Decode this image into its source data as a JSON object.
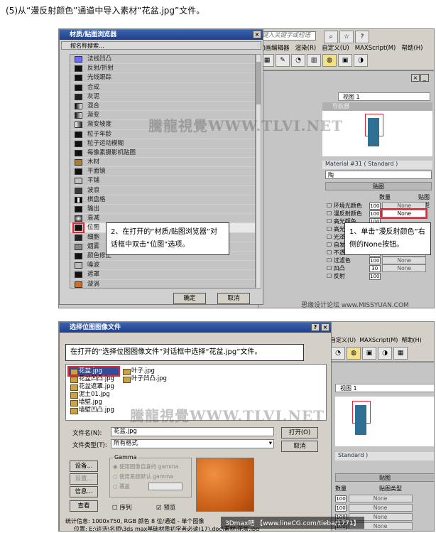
{
  "heading": "(5)从“漫反射颜色”通道中导入素材“花盆.jpg”文件。",
  "top": {
    "browser": {
      "title": "材质/贴图浏览器",
      "search_placeholder": "按名称搜索...",
      "items": [
        {
          "label": "法线凹凸",
          "color": "#6b6bff"
        },
        {
          "label": "反射/折射",
          "color": "#111111"
        },
        {
          "label": "光线跟踪",
          "color": "#111111"
        },
        {
          "label": "合成",
          "color": "#111111"
        },
        {
          "label": "灰泥",
          "color": "#202020"
        },
        {
          "label": "混合",
          "color": "#777777"
        },
        {
          "label": "渐变",
          "color": "#333333"
        },
        {
          "label": "渐变坡度",
          "color": "#999999"
        },
        {
          "label": "粒子年龄",
          "color": "#111111"
        },
        {
          "label": "粒子运动模糊",
          "color": "#111111"
        },
        {
          "label": "每像素摄影机贴图",
          "color": "#111111"
        },
        {
          "label": "木材",
          "color": "#b07a2a"
        },
        {
          "label": "平面镜",
          "color": "#111111"
        },
        {
          "label": "平铺",
          "color": "#c0c0c0"
        },
        {
          "label": "波浪",
          "color": "#3a3a3a"
        },
        {
          "label": "棋盘格",
          "color": "#555555"
        },
        {
          "label": "输出",
          "color": "#111111"
        },
        {
          "label": "衰减",
          "color": "#444444"
        },
        {
          "label": "位图",
          "color": "#111111"
        },
        {
          "label": "细胞",
          "color": "#222222"
        },
        {
          "label": "烟雾",
          "color": "#888888"
        },
        {
          "label": "颜色修正",
          "color": "#111111"
        },
        {
          "label": "噪波",
          "color": "#bbbbbb"
        },
        {
          "label": "遮罩",
          "color": "#111111"
        },
        {
          "label": "漩涡",
          "color": "#d86a1a"
        }
      ],
      "ok": "确定",
      "cancel": "取消"
    },
    "menubar": {
      "search_placeholder": "键入关键字或短语",
      "items": [
        "动画编辑器",
        "渲染(R)",
        "自定义(U)",
        "MAXScript(M)",
        "帮助(H)"
      ]
    },
    "viewport": {
      "label": "视图 1",
      "section": "导航器"
    },
    "material": {
      "name": "Material #31 ( Standard )",
      "field": "陶",
      "rollout": "贴图",
      "col_amount": "数量",
      "col_type": "贴图类型",
      "rows": [
        {
          "label": "环境光颜色",
          "amount": "100",
          "map": "None"
        },
        {
          "label": "漫反射颜色",
          "amount": "100",
          "map": "None"
        },
        {
          "label": "高光颜色",
          "amount": "100",
          "map": "None"
        },
        {
          "label": "高光级别",
          "amount": "100",
          "map": "None"
        },
        {
          "label": "光泽度",
          "amount": "100",
          "map": "None"
        },
        {
          "label": "自发光",
          "amount": "100",
          "map": "None"
        },
        {
          "label": "不透明度",
          "amount": "100",
          "map": "None"
        },
        {
          "label": "过滤色",
          "amount": "100",
          "map": "None"
        },
        {
          "label": "凹凸",
          "amount": "30",
          "map": "None"
        },
        {
          "label": "反射",
          "amount": "100",
          "map": "None"
        }
      ]
    },
    "callout_left": "2、在打开的“材质/贴图浏览器”对话框中双击“位图”选项。",
    "callout_right": "1、单击“漫反射颜色”右侧的None按钮。",
    "watermark": "騰龍視覺WWW.TLVI.NET",
    "footer_watermark": "思缘设计论坛 www.MISSYUAN.COM"
  },
  "bottom": {
    "dialog": {
      "title": "选择位图图像文件",
      "callout": "在打开的“选择位图图像文件”对话框中选择“花盆.jpg”文件。",
      "files_col1": [
        "花盆.jpg",
        "花盆凹凸.jpg",
        "花盆遮罩.jpg",
        "泥土01.jpg",
        "墙壁.jpg",
        "墙壁凹凸.jpg"
      ],
      "files_col2": [
        "叶子.jpg",
        "叶子凹凸.jpg"
      ],
      "filename_label": "文件名(N):",
      "filename_value": "花盆.jpg",
      "filetype_label": "文件类型(T):",
      "filetype_value": "所有格式",
      "open": "打开(O)",
      "cancel": "取消",
      "setup": "设备...",
      "settings": "设置...",
      "info": "信息...",
      "view": "查看",
      "gamma_title": "Gamma",
      "gamma_options": [
        "使用图像自身的 gamma",
        "使用系统默认 gamma",
        "覆盖"
      ],
      "sequence": "序列",
      "preview": "预览",
      "stats": "统计信息: 1000x750, RGB 颜色 8 位/通道 - 单个图像",
      "location": "位置: E:\\许浩\\名师\\3ds max基础材质初学者必读(17).doc\\素材\\花盆.jpg"
    },
    "right": {
      "menu": [
        "自定义(U)",
        "MAXScript(M)",
        "帮助(H)"
      ],
      "viewport": "视图 1",
      "material_suffix": "Standard )",
      "rollout": "贴图",
      "col_amount": "数量",
      "col_type": "贴图类型",
      "rows": [
        {
          "amount": "100",
          "map": "None"
        },
        {
          "amount": "100",
          "map": "None"
        },
        {
          "amount": "100",
          "map": "None"
        },
        {
          "amount": "100",
          "map": "None"
        }
      ]
    },
    "watermark": "騰龍視覺WWW.TLVI.NET",
    "footer": "3Dmax吧 【www.lineCG.com/tieba/1771】"
  }
}
